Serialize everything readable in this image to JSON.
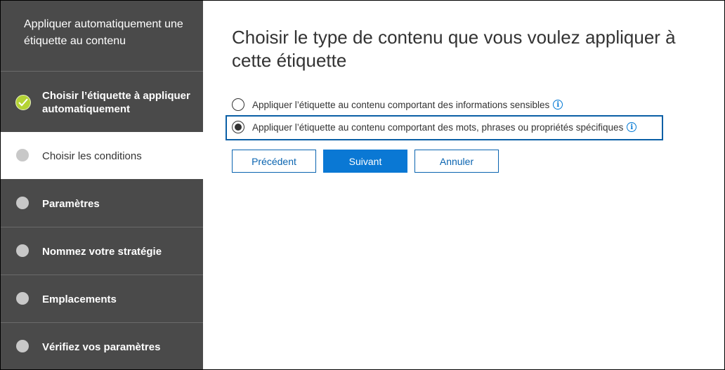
{
  "sidebar": {
    "title": "Appliquer automatiquement une étiquette au contenu",
    "steps": [
      {
        "label": "Choisir l’étiquette à appliquer automatiquement",
        "state": "completed"
      },
      {
        "label": "Choisir les conditions",
        "state": "current"
      },
      {
        "label": "Paramètres",
        "state": "pending"
      },
      {
        "label": "Nommez votre stratégie",
        "state": "pending"
      },
      {
        "label": "Emplacements",
        "state": "pending"
      },
      {
        "label": "Vérifiez vos paramètres",
        "state": "pending"
      }
    ]
  },
  "main": {
    "title": "Choisir le type de contenu que vous voulez appliquer à cette étiquette",
    "options": [
      {
        "label": "Appliquer l’étiquette au contenu comportant des informations sensibles",
        "selected": false,
        "info_icon": "i"
      },
      {
        "label": "Appliquer l’étiquette au contenu comportant des mots, phrases ou propriétés spécifiques",
        "selected": true,
        "info_icon": "i"
      }
    ],
    "buttons": {
      "back": "Précédent",
      "next": "Suivant",
      "cancel": "Annuler"
    }
  },
  "colors": {
    "sidebar_bg": "#4a4a4a",
    "accent": "#0a78d4",
    "check_green": "#b4d334"
  }
}
